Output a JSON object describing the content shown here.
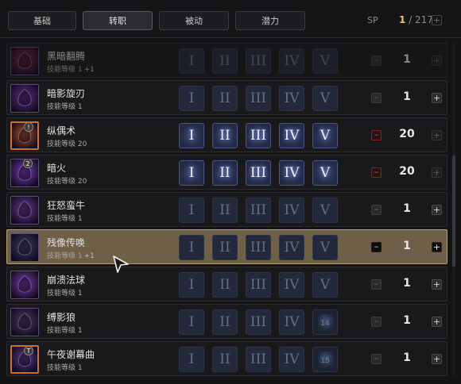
{
  "tabs": [
    {
      "label": "基础",
      "active": false
    },
    {
      "label": "转职",
      "active": true
    },
    {
      "label": "被动",
      "active": false
    },
    {
      "label": "潜力",
      "active": false
    }
  ],
  "sp": {
    "label": "SP",
    "current": "1",
    "total": "/ 217",
    "plus": "+"
  },
  "tier_labels": [
    "I",
    "II",
    "III",
    "IV",
    "V"
  ],
  "level_prefix": "技能等级",
  "skills": [
    {
      "name": "黑暗翻腾",
      "level": "1",
      "bonus": "+1",
      "points": "1",
      "active_tiers": 0,
      "icon": "dark-somersault-icon",
      "icon_color": "#8a1f3a",
      "faded": true,
      "minus": "normal",
      "plus": "dim"
    },
    {
      "name": "暗影旋刃",
      "level": "1",
      "bonus": "",
      "points": "1",
      "active_tiers": 0,
      "icon": "shadow-blade-icon",
      "icon_color": "#5a2f8a",
      "minus": "normal",
      "plus": "normal"
    },
    {
      "name": "纵偶术",
      "level": "20",
      "bonus": "",
      "points": "20",
      "active_tiers": 5,
      "icon": "puppetry-icon",
      "icon_color": "#b0531f",
      "badge": "!",
      "orange": true,
      "minus": "red",
      "plus": "dim"
    },
    {
      "name": "暗火",
      "level": "20",
      "bonus": "",
      "points": "20",
      "active_tiers": 5,
      "icon": "dark-fire-icon",
      "icon_color": "#7d3ec4",
      "badge": "2",
      "minus": "red",
      "plus": "dim"
    },
    {
      "name": "狂怒蛮牛",
      "level": "1",
      "bonus": "",
      "points": "1",
      "active_tiers": 0,
      "icon": "raging-bull-icon",
      "icon_color": "#6a3d9a",
      "minus": "normal",
      "plus": "normal"
    },
    {
      "name": "残像传唤",
      "level": "1",
      "bonus": "+1",
      "points": "1",
      "active_tiers": 0,
      "icon": "afterimage-summon-icon",
      "icon_color": "#3a3f66",
      "selected": true,
      "minus": "dark",
      "plus": "dark"
    },
    {
      "name": "崩溃法球",
      "level": "1",
      "bonus": "",
      "points": "1",
      "active_tiers": 0,
      "icon": "collapse-orb-icon",
      "icon_color": "#7b3fb0",
      "minus": "normal",
      "plus": "normal"
    },
    {
      "name": "缚影狼",
      "level": "1",
      "bonus": "",
      "points": "1",
      "active_tiers": 0,
      "icon": "shadow-wolf-icon",
      "icon_color": "#4a3a6a",
      "alt_tier": "14",
      "minus": "normal",
      "plus": "normal"
    },
    {
      "name": "午夜谢幕曲",
      "level": "1",
      "bonus": "",
      "points": "1",
      "active_tiers": 0,
      "icon": "midnight-finale-icon",
      "icon_color": "#5a3a88",
      "badge": "T",
      "orange": true,
      "alt_tier": "15",
      "minus": "normal",
      "plus": "normal"
    }
  ]
}
